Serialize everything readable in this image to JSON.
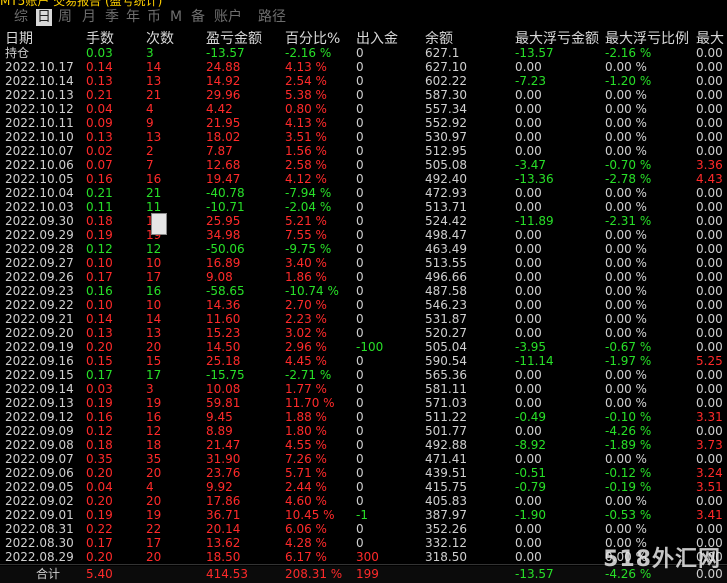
{
  "topbar_text": "MT5账户 交易报告 (盈亏统计)",
  "tabs": [
    "综",
    "日",
    "周",
    "月",
    "季",
    "年",
    "币",
    "M",
    "备",
    "账户",
    "路径"
  ],
  "active_tab": 1,
  "headers": [
    "日期",
    "手数",
    "次数",
    "盈亏金额",
    "百分比%",
    "出入金",
    "余额",
    "最大浮亏金额",
    "最大浮亏比例",
    "最大"
  ],
  "position_row": {
    "date": "持仓",
    "lots": "0.03",
    "count": "3",
    "pl": "-13.57",
    "pct": "-2.16 %",
    "io": "0",
    "bal": "627.1",
    "mfl": "-13.57",
    "mflp": "-2.16 %",
    "last": "0.00",
    "side": "g"
  },
  "rows": [
    {
      "date": "2022.10.17",
      "lots": "0.14",
      "count": "14",
      "pl": "24.88",
      "pct": "4.13 %",
      "io": "0",
      "bal": "627.10",
      "mfl": "0.00",
      "mflp": "0.00 %",
      "last": "0.00",
      "side": "r"
    },
    {
      "date": "2022.10.14",
      "lots": "0.13",
      "count": "13",
      "pl": "14.92",
      "pct": "2.54 %",
      "io": "0",
      "bal": "602.22",
      "mfl": "-7.23",
      "mflp": "-1.20 %",
      "last": "0.00",
      "side": "r"
    },
    {
      "date": "2022.10.13",
      "lots": "0.21",
      "count": "21",
      "pl": "29.96",
      "pct": "5.38 %",
      "io": "0",
      "bal": "587.30",
      "mfl": "0.00",
      "mflp": "0.00 %",
      "last": "0.00",
      "side": "r"
    },
    {
      "date": "2022.10.12",
      "lots": "0.04",
      "count": "4",
      "pl": "4.42",
      "pct": "0.80 %",
      "io": "0",
      "bal": "557.34",
      "mfl": "0.00",
      "mflp": "0.00 %",
      "last": "0.00",
      "side": "r"
    },
    {
      "date": "2022.10.11",
      "lots": "0.09",
      "count": "9",
      "pl": "21.95",
      "pct": "4.13 %",
      "io": "0",
      "bal": "552.92",
      "mfl": "0.00",
      "mflp": "0.00 %",
      "last": "0.00",
      "side": "r"
    },
    {
      "date": "2022.10.10",
      "lots": "0.13",
      "count": "13",
      "pl": "18.02",
      "pct": "3.51 %",
      "io": "0",
      "bal": "530.97",
      "mfl": "0.00",
      "mflp": "0.00 %",
      "last": "0.00",
      "side": "r"
    },
    {
      "date": "2022.10.07",
      "lots": "0.02",
      "count": "2",
      "pl": "7.87",
      "pct": "1.56 %",
      "io": "0",
      "bal": "512.95",
      "mfl": "0.00",
      "mflp": "0.00 %",
      "last": "0.00",
      "side": "r"
    },
    {
      "date": "2022.10.06",
      "lots": "0.07",
      "count": "7",
      "pl": "12.68",
      "pct": "2.58 %",
      "io": "0",
      "bal": "505.08",
      "mfl": "-3.47",
      "mflp": "-0.70 %",
      "last": "3.36",
      "side": "r",
      "lastRed": true
    },
    {
      "date": "2022.10.05",
      "lots": "0.16",
      "count": "16",
      "pl": "19.47",
      "pct": "4.12 %",
      "io": "0",
      "bal": "492.40",
      "mfl": "-13.36",
      "mflp": "-2.78 %",
      "last": "4.43",
      "side": "r",
      "lastRed": true
    },
    {
      "date": "2022.10.04",
      "lots": "0.21",
      "count": "21",
      "pl": "-40.78",
      "pct": "-7.94 %",
      "io": "0",
      "bal": "472.93",
      "mfl": "0.00",
      "mflp": "0.00 %",
      "last": "0.00",
      "side": "g"
    },
    {
      "date": "2022.10.03",
      "lots": "0.11",
      "count": "11",
      "pl": "-10.71",
      "pct": "-2.04 %",
      "io": "0",
      "bal": "513.71",
      "mfl": "0.00",
      "mflp": "0.00 %",
      "last": "0.00",
      "side": "g"
    },
    {
      "date": "2022.09.30",
      "lots": "0.18",
      "count": "18",
      "pl": "25.95",
      "pct": "5.21 %",
      "io": "0",
      "bal": "524.42",
      "mfl": "-11.89",
      "mflp": "-2.31 %",
      "last": "0.00",
      "side": "r"
    },
    {
      "date": "2022.09.29",
      "lots": "0.19",
      "count": "19",
      "pl": "34.98",
      "pct": "7.55 %",
      "io": "0",
      "bal": "498.47",
      "mfl": "0.00",
      "mflp": "0.00 %",
      "last": "0.00",
      "side": "r"
    },
    {
      "date": "2022.09.28",
      "lots": "0.12",
      "count": "12",
      "pl": "-50.06",
      "pct": "-9.75 %",
      "io": "0",
      "bal": "463.49",
      "mfl": "0.00",
      "mflp": "0.00 %",
      "last": "0.00",
      "side": "g"
    },
    {
      "date": "2022.09.27",
      "lots": "0.10",
      "count": "10",
      "pl": "16.89",
      "pct": "3.40 %",
      "io": "0",
      "bal": "513.55",
      "mfl": "0.00",
      "mflp": "0.00 %",
      "last": "0.00",
      "side": "r"
    },
    {
      "date": "2022.09.26",
      "lots": "0.17",
      "count": "17",
      "pl": "9.08",
      "pct": "1.86 %",
      "io": "0",
      "bal": "496.66",
      "mfl": "0.00",
      "mflp": "0.00 %",
      "last": "0.00",
      "side": "r"
    },
    {
      "date": "2022.09.23",
      "lots": "0.16",
      "count": "16",
      "pl": "-58.65",
      "pct": "-10.74 %",
      "io": "0",
      "bal": "487.58",
      "mfl": "0.00",
      "mflp": "0.00 %",
      "last": "0.00",
      "side": "g"
    },
    {
      "date": "2022.09.22",
      "lots": "0.10",
      "count": "10",
      "pl": "14.36",
      "pct": "2.70 %",
      "io": "0",
      "bal": "546.23",
      "mfl": "0.00",
      "mflp": "0.00 %",
      "last": "0.00",
      "side": "r"
    },
    {
      "date": "2022.09.21",
      "lots": "0.14",
      "count": "14",
      "pl": "11.60",
      "pct": "2.23 %",
      "io": "0",
      "bal": "531.87",
      "mfl": "0.00",
      "mflp": "0.00 %",
      "last": "0.00",
      "side": "r"
    },
    {
      "date": "2022.09.20",
      "lots": "0.13",
      "count": "13",
      "pl": "15.23",
      "pct": "3.02 %",
      "io": "0",
      "bal": "520.27",
      "mfl": "0.00",
      "mflp": "0.00 %",
      "last": "0.00",
      "side": "r"
    },
    {
      "date": "2022.09.19",
      "lots": "0.20",
      "count": "20",
      "pl": "14.50",
      "pct": "2.96 %",
      "io": "-100",
      "bal": "505.04",
      "mfl": "-3.95",
      "mflp": "-0.67 %",
      "last": "0.00",
      "side": "r",
      "ioGreen": true
    },
    {
      "date": "2022.09.16",
      "lots": "0.15",
      "count": "15",
      "pl": "25.18",
      "pct": "4.45 %",
      "io": "0",
      "bal": "590.54",
      "mfl": "-11.14",
      "mflp": "-1.97 %",
      "last": "5.25",
      "side": "r",
      "lastRed": true
    },
    {
      "date": "2022.09.15",
      "lots": "0.17",
      "count": "17",
      "pl": "-15.75",
      "pct": "-2.71 %",
      "io": "0",
      "bal": "565.36",
      "mfl": "0.00",
      "mflp": "0.00 %",
      "last": "0.00",
      "side": "g"
    },
    {
      "date": "2022.09.14",
      "lots": "0.03",
      "count": "3",
      "pl": "10.08",
      "pct": "1.77 %",
      "io": "0",
      "bal": "581.11",
      "mfl": "0.00",
      "mflp": "0.00 %",
      "last": "0.00",
      "side": "r"
    },
    {
      "date": "2022.09.13",
      "lots": "0.19",
      "count": "19",
      "pl": "59.81",
      "pct": "11.70 %",
      "io": "0",
      "bal": "571.03",
      "mfl": "0.00",
      "mflp": "0.00 %",
      "last": "0.00",
      "side": "r"
    },
    {
      "date": "2022.09.12",
      "lots": "0.16",
      "count": "16",
      "pl": "9.45",
      "pct": "1.88 %",
      "io": "0",
      "bal": "511.22",
      "mfl": "-0.49",
      "mflp": "-0.10 %",
      "last": "3.31",
      "side": "r",
      "lastRed": true
    },
    {
      "date": "2022.09.09",
      "lots": "0.12",
      "count": "12",
      "pl": "8.89",
      "pct": "1.80 %",
      "io": "0",
      "bal": "501.77",
      "mfl": "0.00",
      "mflp": "-4.26 %",
      "last": "0.00",
      "side": "r"
    },
    {
      "date": "2022.09.08",
      "lots": "0.18",
      "count": "18",
      "pl": "21.47",
      "pct": "4.55 %",
      "io": "0",
      "bal": "492.88",
      "mfl": "-8.92",
      "mflp": "-1.89 %",
      "last": "3.73",
      "side": "r",
      "lastRed": true
    },
    {
      "date": "2022.09.07",
      "lots": "0.35",
      "count": "35",
      "pl": "31.90",
      "pct": "7.26 %",
      "io": "0",
      "bal": "471.41",
      "mfl": "0.00",
      "mflp": "0.00 %",
      "last": "0.00",
      "side": "r"
    },
    {
      "date": "2022.09.06",
      "lots": "0.20",
      "count": "20",
      "pl": "23.76",
      "pct": "5.71 %",
      "io": "0",
      "bal": "439.51",
      "mfl": "-0.51",
      "mflp": "-0.12 %",
      "last": "3.24",
      "side": "r",
      "lastRed": true
    },
    {
      "date": "2022.09.05",
      "lots": "0.04",
      "count": "4",
      "pl": "9.92",
      "pct": "2.44 %",
      "io": "0",
      "bal": "415.75",
      "mfl": "-0.79",
      "mflp": "-0.19 %",
      "last": "3.51",
      "side": "r",
      "lastRed": true
    },
    {
      "date": "2022.09.02",
      "lots": "0.20",
      "count": "20",
      "pl": "17.86",
      "pct": "4.60 %",
      "io": "0",
      "bal": "405.83",
      "mfl": "0.00",
      "mflp": "0.00 %",
      "last": "0.00",
      "side": "r"
    },
    {
      "date": "2022.09.01",
      "lots": "0.19",
      "count": "19",
      "pl": "36.71",
      "pct": "10.45 %",
      "io": "-1",
      "bal": "387.97",
      "mfl": "-1.90",
      "mflp": "-0.53 %",
      "last": "3.41",
      "side": "r",
      "ioGreen": true,
      "lastRed": true
    },
    {
      "date": "2022.08.31",
      "lots": "0.22",
      "count": "22",
      "pl": "20.14",
      "pct": "6.06 %",
      "io": "0",
      "bal": "352.26",
      "mfl": "0.00",
      "mflp": "0.00 %",
      "last": "0.00",
      "side": "r"
    },
    {
      "date": "2022.08.30",
      "lots": "0.17",
      "count": "17",
      "pl": "13.62",
      "pct": "4.28 %",
      "io": "0",
      "bal": "332.12",
      "mfl": "0.00",
      "mflp": "0.00 %",
      "last": "0.00",
      "side": "r"
    },
    {
      "date": "2022.08.29",
      "lots": "0.20",
      "count": "20",
      "pl": "18.50",
      "pct": "6.17 %",
      "io": "300",
      "bal": "318.50",
      "mfl": "0.00",
      "mflp": "0.00 %",
      "last": "0.00",
      "side": "r",
      "ioRed": true
    }
  ],
  "total": {
    "label": "合计",
    "lots": "5.40",
    "pl": "414.53",
    "pct": "208.31 %",
    "io": "199",
    "mfl": "-13.57",
    "mflp": "-4.26 %",
    "last": "0.00"
  },
  "watermark": "518外汇网",
  "colors": {
    "gain": "#ff2a2a",
    "loss": "#28e028",
    "neutral": "#d0d0d0",
    "background": "#000000"
  }
}
